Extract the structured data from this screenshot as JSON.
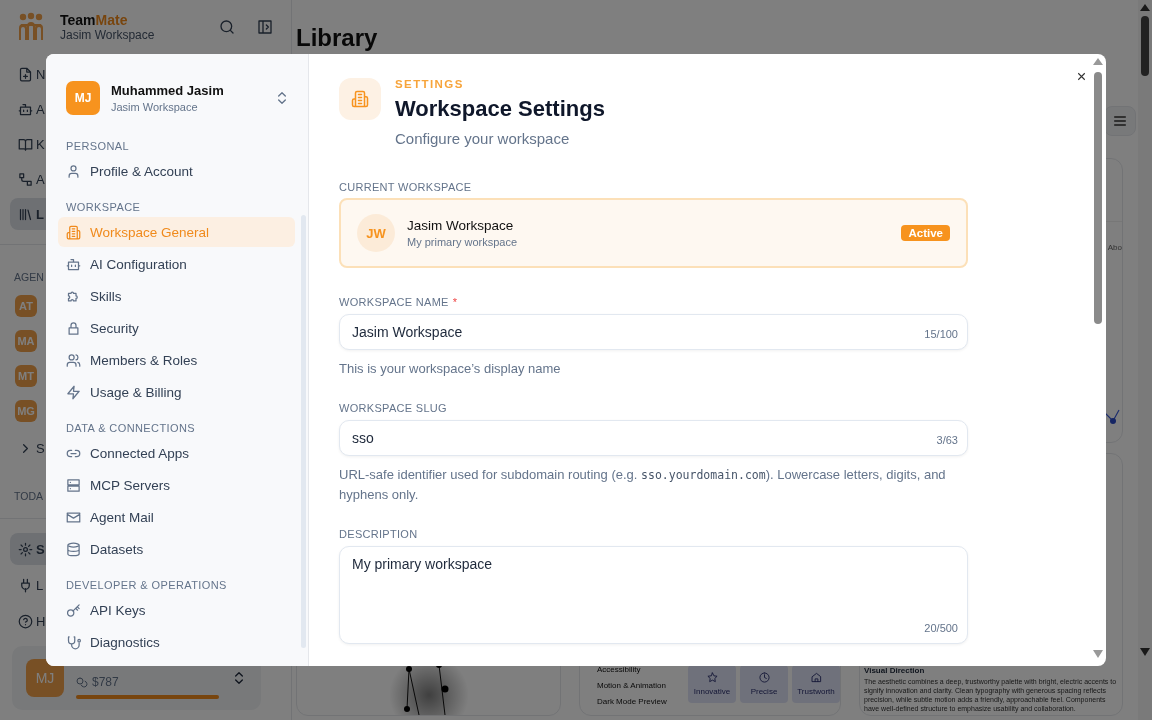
{
  "app": {
    "brand_first": "Team",
    "brand_second": "Mate",
    "workspace": "Jasim Workspace"
  },
  "nav": [
    {
      "label": "N",
      "selected": false
    },
    {
      "label": "A",
      "selected": false
    },
    {
      "label": "K",
      "selected": false
    },
    {
      "label": "A",
      "selected": false
    },
    {
      "label": "L",
      "selected": true
    }
  ],
  "agents_heading": "AGEN",
  "agents": [
    {
      "initials": "AT"
    },
    {
      "initials": "MA"
    },
    {
      "initials": "MT"
    },
    {
      "initials": "MG"
    }
  ],
  "show_more": "S",
  "today_heading": "TODA",
  "bottom_nav": [
    {
      "label": "S",
      "selected": true
    },
    {
      "label": "L",
      "selected": false
    },
    {
      "label": "H",
      "selected": false
    }
  ],
  "user_card": {
    "initials": "MJ",
    "balance": "$787",
    "level": 1
  },
  "page_title": "Library",
  "right_card_text": "Abo",
  "design_rows": [
    "Accessibility",
    "Motion & Animation",
    "Dark Mode Preview"
  ],
  "traits": [
    "Innovative",
    "Precise",
    "Trustworth"
  ],
  "visual_direction": {
    "title": "Visual Direction",
    "text": "The aesthetic combines a deep, trustworthy palette with bright, electric accents to signify innovation and clarity. Clean typography with generous spacing reflects precision, while subtle motion adds a friendly, approachable feel. Components have well-defined structure to emphasize usability and collaboration."
  },
  "modal": {
    "profile": {
      "initials": "MJ",
      "name": "Muhammed Jasim",
      "workspace": "Jasim Workspace"
    },
    "sections": [
      {
        "heading": "PERSONAL",
        "items": [
          {
            "label": "Profile & Account",
            "selected": false
          }
        ]
      },
      {
        "heading": "WORKSPACE",
        "items": [
          {
            "label": "Workspace General",
            "selected": true
          },
          {
            "label": "AI Configuration",
            "selected": false
          },
          {
            "label": "Skills",
            "selected": false
          },
          {
            "label": "Security",
            "selected": false
          },
          {
            "label": "Members & Roles",
            "selected": false
          },
          {
            "label": "Usage & Billing",
            "selected": false
          }
        ]
      },
      {
        "heading": "DATA & CONNECTIONS",
        "items": [
          {
            "label": "Connected Apps",
            "selected": false
          },
          {
            "label": "MCP Servers",
            "selected": false
          },
          {
            "label": "Agent Mail",
            "selected": false
          },
          {
            "label": "Datasets",
            "selected": false
          }
        ]
      },
      {
        "heading": "DEVELOPER & OPERATIONS",
        "items": [
          {
            "label": "API Keys",
            "selected": false
          },
          {
            "label": "Diagnostics",
            "selected": false
          }
        ]
      }
    ],
    "eyebrow": "SETTINGS",
    "title": "Workspace Settings",
    "subtitle": "Configure your workspace",
    "current": {
      "label": "CURRENT WORKSPACE",
      "initials": "JW",
      "name": "Jasim Workspace",
      "description": "My primary workspace",
      "badge": "Active"
    },
    "fields": [
      {
        "kind": "input",
        "label": "WORKSPACE NAME",
        "required_mark": "*",
        "value": "Jasim Workspace",
        "counter": "15/100",
        "help": [
          {
            "kind": "text",
            "text": "This is your workspace’s display name"
          }
        ]
      },
      {
        "kind": "input",
        "label": "WORKSPACE SLUG",
        "value": "sso",
        "counter": "3/63",
        "help": [
          {
            "kind": "text",
            "text": "URL-safe identifier used for subdomain routing (e.g. "
          },
          {
            "kind": "code",
            "text": "sso.yourdomain.com"
          },
          {
            "kind": "text",
            "text": "). Lowercase letters, digits, and hyphens only."
          }
        ]
      },
      {
        "kind": "textarea",
        "label": "DESCRIPTION",
        "value": "My primary workspace",
        "counter": "20/500"
      }
    ]
  }
}
